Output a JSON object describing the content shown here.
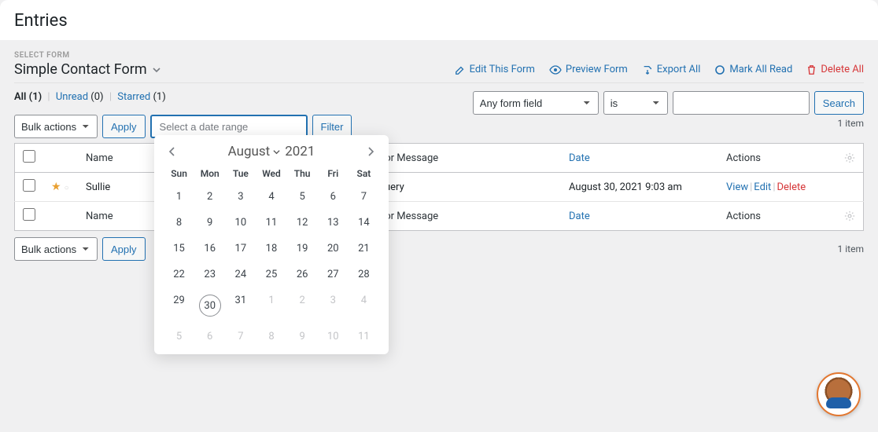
{
  "page": {
    "title": "Entries",
    "select_form_label": "SELECT FORM",
    "form_name": "Simple Contact Form"
  },
  "form_actions": {
    "edit": "Edit This Form",
    "preview": "Preview Form",
    "export": "Export All",
    "mark_read": "Mark All Read",
    "delete_all": "Delete All"
  },
  "status_links": {
    "all": {
      "label": "All",
      "count": "(1)"
    },
    "unread": {
      "label": "Unread",
      "count": "(0)"
    },
    "starred": {
      "label": "Starred",
      "count": "(1)"
    }
  },
  "toolbar": {
    "bulk_label": "Bulk actions",
    "apply": "Apply",
    "date_placeholder": "Select a date range",
    "filter": "Filter",
    "field_label": "Any form field",
    "op_label": "is",
    "search": "Search",
    "item_count": "1 item"
  },
  "columns": {
    "name": "Name",
    "comment": "Comment or Message",
    "date": "Date",
    "actions": "Actions"
  },
  "rows": [
    {
      "name": "Sullie",
      "comment": "Pre-Sale Query",
      "date": "August 30, 2021 9:03 am",
      "actions": {
        "view": "View",
        "edit": "Edit",
        "delete": "Delete"
      }
    }
  ],
  "calendar": {
    "month": "August",
    "year": "2021",
    "dow": [
      "Sun",
      "Mon",
      "Tue",
      "Wed",
      "Thu",
      "Fri",
      "Sat"
    ],
    "weeks": [
      [
        {
          "n": "1"
        },
        {
          "n": "2"
        },
        {
          "n": "3"
        },
        {
          "n": "4"
        },
        {
          "n": "5"
        },
        {
          "n": "6"
        },
        {
          "n": "7"
        }
      ],
      [
        {
          "n": "8"
        },
        {
          "n": "9"
        },
        {
          "n": "10"
        },
        {
          "n": "11"
        },
        {
          "n": "12"
        },
        {
          "n": "13"
        },
        {
          "n": "14"
        }
      ],
      [
        {
          "n": "15"
        },
        {
          "n": "16"
        },
        {
          "n": "17"
        },
        {
          "n": "18"
        },
        {
          "n": "19"
        },
        {
          "n": "20"
        },
        {
          "n": "21"
        }
      ],
      [
        {
          "n": "22"
        },
        {
          "n": "23"
        },
        {
          "n": "24"
        },
        {
          "n": "25"
        },
        {
          "n": "26"
        },
        {
          "n": "27"
        },
        {
          "n": "28"
        }
      ],
      [
        {
          "n": "29"
        },
        {
          "n": "30",
          "today": true
        },
        {
          "n": "31"
        },
        {
          "n": "1",
          "muted": true
        },
        {
          "n": "2",
          "muted": true
        },
        {
          "n": "3",
          "muted": true
        },
        {
          "n": "4",
          "muted": true
        }
      ],
      [
        {
          "n": "5",
          "muted": true
        },
        {
          "n": "6",
          "muted": true
        },
        {
          "n": "7",
          "muted": true
        },
        {
          "n": "8",
          "muted": true
        },
        {
          "n": "9",
          "muted": true
        },
        {
          "n": "10",
          "muted": true
        },
        {
          "n": "11",
          "muted": true
        }
      ]
    ]
  }
}
